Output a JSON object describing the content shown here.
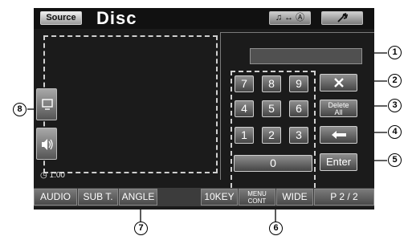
{
  "header": {
    "source_label": "Source",
    "title": "Disc",
    "audio_nav_icon": "music-note-swap-navigation-icon",
    "setup_icon": "wrench-icon"
  },
  "screen": {
    "time": "1:00",
    "visual_side_icon": "display-icon",
    "audio_side_icon": "speaker-icon"
  },
  "keypad": {
    "keys": [
      "7",
      "8",
      "9",
      "4",
      "5",
      "6",
      "1",
      "2",
      "3"
    ],
    "zero": "0",
    "delete_icon": "x-icon",
    "delete_all_line1": "Delete",
    "delete_all_line2": "All",
    "backspace_icon": "left-arrow-icon",
    "enter": "Enter"
  },
  "bottom": {
    "audio": "AUDIO",
    "subt": "SUB T.",
    "angle": "ANGLE",
    "tenkey": "10KEY",
    "menu_line1": "MENU",
    "menu_line2": "CONT",
    "wide": "WIDE",
    "page": "P  2 / 2"
  },
  "callouts": [
    "1",
    "2",
    "3",
    "4",
    "5",
    "6",
    "7",
    "8"
  ]
}
